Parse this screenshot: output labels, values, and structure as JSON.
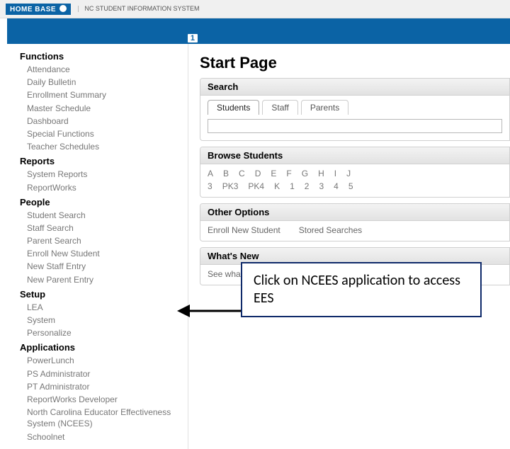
{
  "brand": {
    "logo_text": "HOME BASE",
    "system_name": "NC STUDENT\nINFORMATION SYSTEM"
  },
  "badge": "1",
  "sidebar": {
    "sections": [
      {
        "title": "Functions",
        "items": [
          "Attendance",
          "Daily Bulletin",
          "Enrollment Summary",
          "Master Schedule",
          "Dashboard",
          "Special Functions",
          "Teacher Schedules"
        ]
      },
      {
        "title": "Reports",
        "items": [
          "System Reports",
          "ReportWorks"
        ]
      },
      {
        "title": "People",
        "items": [
          "Student Search",
          "Staff Search",
          "Parent Search",
          "Enroll New Student",
          "New Staff Entry",
          "New Parent Entry"
        ]
      },
      {
        "title": "Setup",
        "items": [
          "LEA",
          "System",
          "Personalize"
        ]
      },
      {
        "title": "Applications",
        "items": [
          "PowerLunch",
          "PS Administrator",
          "PT Administrator",
          "ReportWorks Developer",
          "North Carolina Educator Effectiveness System (NCEES)",
          "Schoolnet"
        ]
      }
    ]
  },
  "main": {
    "title": "Start Page",
    "search": {
      "heading": "Search",
      "tabs": [
        "Students",
        "Staff",
        "Parents"
      ],
      "input_placeholder": ""
    },
    "browse": {
      "heading": "Browse Students",
      "letters": [
        "A",
        "B",
        "C",
        "D",
        "E",
        "F",
        "G",
        "H",
        "I",
        "J"
      ],
      "grades": [
        "3",
        "PK3",
        "PK4",
        "K",
        "1",
        "2",
        "3",
        "4",
        "5"
      ]
    },
    "other": {
      "heading": "Other Options",
      "links": [
        "Enroll New Student",
        "Stored Searches"
      ]
    },
    "whatsnew": {
      "heading": "What's New",
      "body": "See what's new in the latest feature rele"
    }
  },
  "callout": {
    "text": "Click on NCEES application to access EES"
  }
}
